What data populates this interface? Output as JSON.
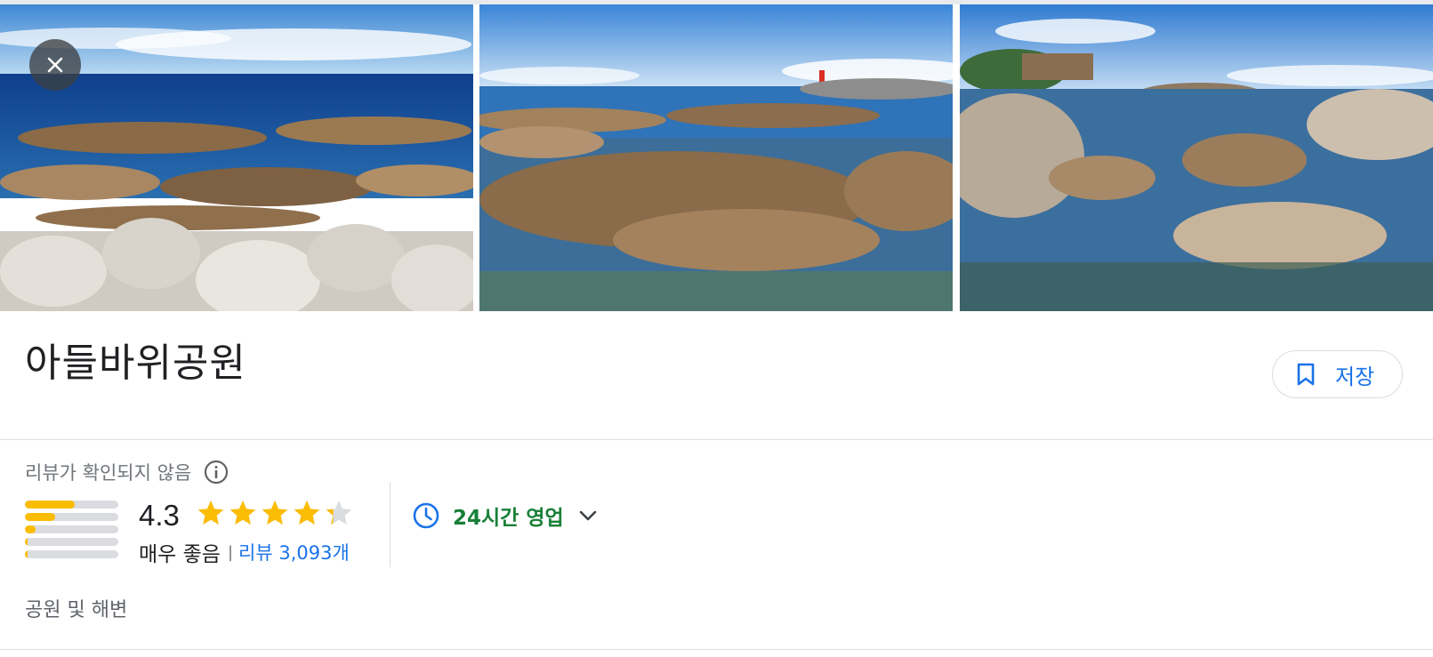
{
  "place": {
    "name": "아들바위공원",
    "category": "공원 및 해변"
  },
  "actions": {
    "save_label": "저장"
  },
  "icons": {
    "close": "close-icon",
    "bookmark": "bookmark-icon",
    "info": "info-icon",
    "clock": "clock-icon",
    "expand": "chevron-down-icon",
    "star": "star-icon"
  },
  "rating": {
    "unverified_label": "리뷰가 확인되지 않음",
    "score": "4.3",
    "stars_value": 4.3,
    "word": "매우 좋음",
    "separator": "|",
    "reviews_label": "리뷰 3,093개",
    "distribution": [
      0.53,
      0.32,
      0.11,
      0.03,
      0.03
    ]
  },
  "hours": {
    "label": "24시간 영업"
  },
  "colors": {
    "star": "#fbbc04",
    "star_empty": "#dadce0",
    "link": "#1a73e8",
    "open": "#188038"
  },
  "photos": [
    {
      "subject": "tetrapods-and-rocky-shore"
    },
    {
      "subject": "large-rocks-and-lighthouse"
    },
    {
      "subject": "rocky-coast-with-pavilion"
    }
  ]
}
